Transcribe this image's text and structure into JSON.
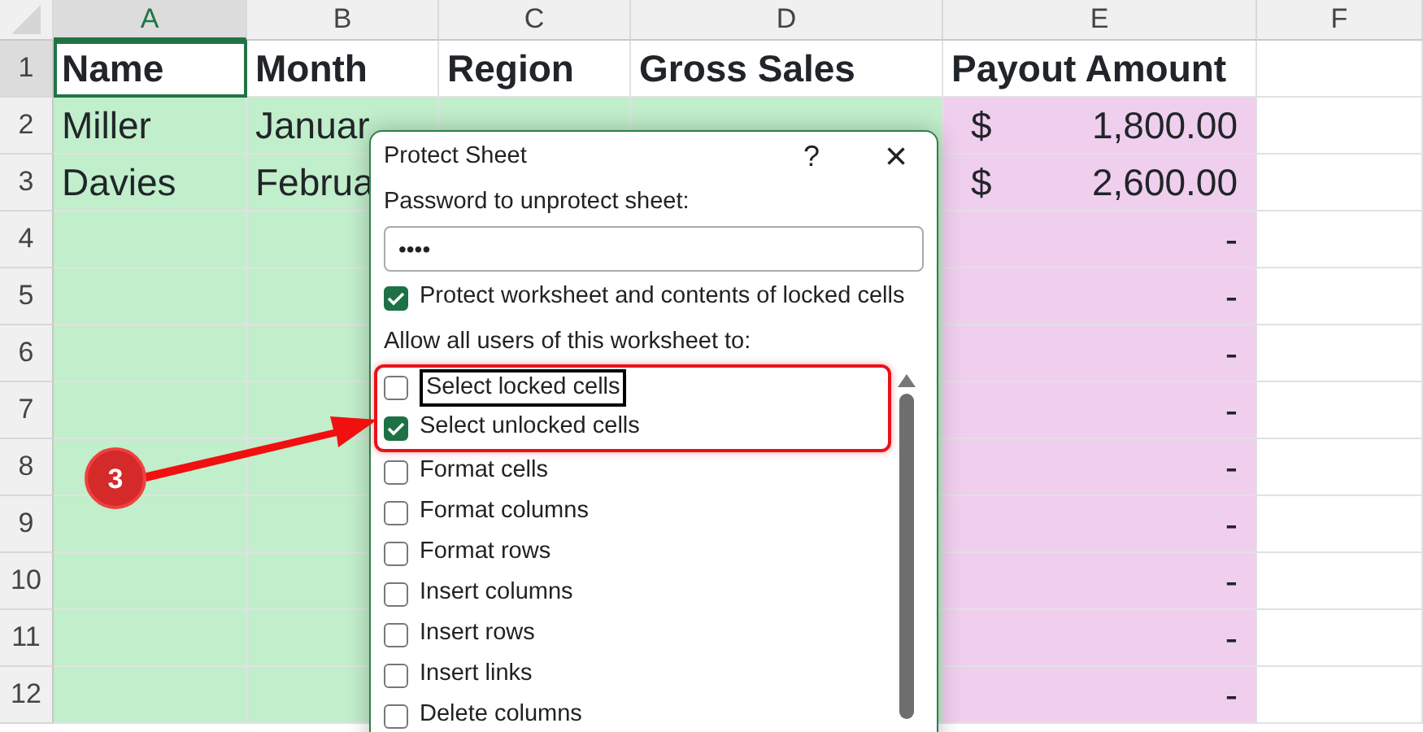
{
  "sheet": {
    "columns": [
      {
        "label": "A",
        "selected": true,
        "color": "#c1eecb"
      },
      {
        "label": "B",
        "selected": false,
        "color": "#c1eecb"
      },
      {
        "label": "C",
        "selected": false,
        "color": "#c1eecb"
      },
      {
        "label": "D",
        "selected": false,
        "color": "#c1eecb"
      },
      {
        "label": "E",
        "selected": false,
        "color": "#f0cfee"
      },
      {
        "label": "F",
        "selected": false,
        "color": "#ffffff"
      }
    ],
    "rows": [
      {
        "label": "1",
        "selected": true,
        "cells": [
          {
            "text": "Name",
            "selected": true
          },
          {
            "text": "Month"
          },
          {
            "text": "Region"
          },
          {
            "text": "Gross Sales"
          },
          {
            "text": "Payout Amount"
          },
          {}
        ]
      },
      {
        "label": "2",
        "selected": false,
        "cells": [
          {
            "text": "Miller"
          },
          {
            "text": "Januar"
          },
          {},
          {},
          {
            "symbol": "$",
            "amount": "1,800.00"
          },
          {}
        ]
      },
      {
        "label": "3",
        "selected": false,
        "cells": [
          {
            "text": "Davies"
          },
          {
            "text": "Februa"
          },
          {},
          {},
          {
            "symbol": "$",
            "amount": "2,600.00"
          },
          {}
        ]
      },
      {
        "label": "4",
        "selected": false,
        "cells": [
          {},
          {},
          {},
          {},
          {
            "amount": "-"
          },
          {}
        ]
      },
      {
        "label": "5",
        "selected": false,
        "cells": [
          {},
          {},
          {},
          {},
          {
            "amount": "-"
          },
          {}
        ]
      },
      {
        "label": "6",
        "selected": false,
        "cells": [
          {},
          {},
          {},
          {},
          {
            "amount": "-"
          },
          {}
        ]
      },
      {
        "label": "7",
        "selected": false,
        "cells": [
          {},
          {},
          {},
          {},
          {
            "amount": "-"
          },
          {}
        ]
      },
      {
        "label": "8",
        "selected": false,
        "cells": [
          {},
          {},
          {},
          {},
          {
            "amount": "-"
          },
          {}
        ]
      },
      {
        "label": "9",
        "selected": false,
        "cells": [
          {},
          {},
          {},
          {},
          {
            "amount": "-"
          },
          {}
        ]
      },
      {
        "label": "10",
        "selected": false,
        "cells": [
          {},
          {},
          {},
          {},
          {
            "amount": "-"
          },
          {}
        ]
      },
      {
        "label": "11",
        "selected": false,
        "cells": [
          {},
          {},
          {},
          {},
          {
            "amount": "-"
          },
          {}
        ]
      },
      {
        "label": "12",
        "selected": false,
        "cells": [
          {},
          {},
          {},
          {},
          {
            "amount": "-"
          },
          {}
        ]
      }
    ]
  },
  "dialog": {
    "title": "Protect Sheet",
    "help": "?",
    "close": "×",
    "password": {
      "label": "Password to unprotect sheet:",
      "value": "••••"
    },
    "protect": {
      "label": "Protect worksheet and contents of locked cells",
      "checked": true
    },
    "allow_label": "Allow all users of this worksheet to:",
    "permissions": [
      {
        "label": "Select locked cells",
        "checked": false,
        "focused": true,
        "highlighted": true
      },
      {
        "label": "Select unlocked cells",
        "checked": true,
        "focused": false,
        "highlighted": true
      },
      {
        "label": "Format cells",
        "checked": false,
        "focused": false,
        "highlighted": false
      },
      {
        "label": "Format columns",
        "checked": false,
        "focused": false,
        "highlighted": false
      },
      {
        "label": "Format rows",
        "checked": false,
        "focused": false,
        "highlighted": false
      },
      {
        "label": "Insert columns",
        "checked": false,
        "focused": false,
        "highlighted": false
      },
      {
        "label": "Insert rows",
        "checked": false,
        "focused": false,
        "highlighted": false
      },
      {
        "label": "Insert links",
        "checked": false,
        "focused": false,
        "highlighted": false
      },
      {
        "label": "Delete columns",
        "checked": false,
        "focused": false,
        "highlighted": false
      }
    ]
  },
  "callout": {
    "label": "3"
  }
}
